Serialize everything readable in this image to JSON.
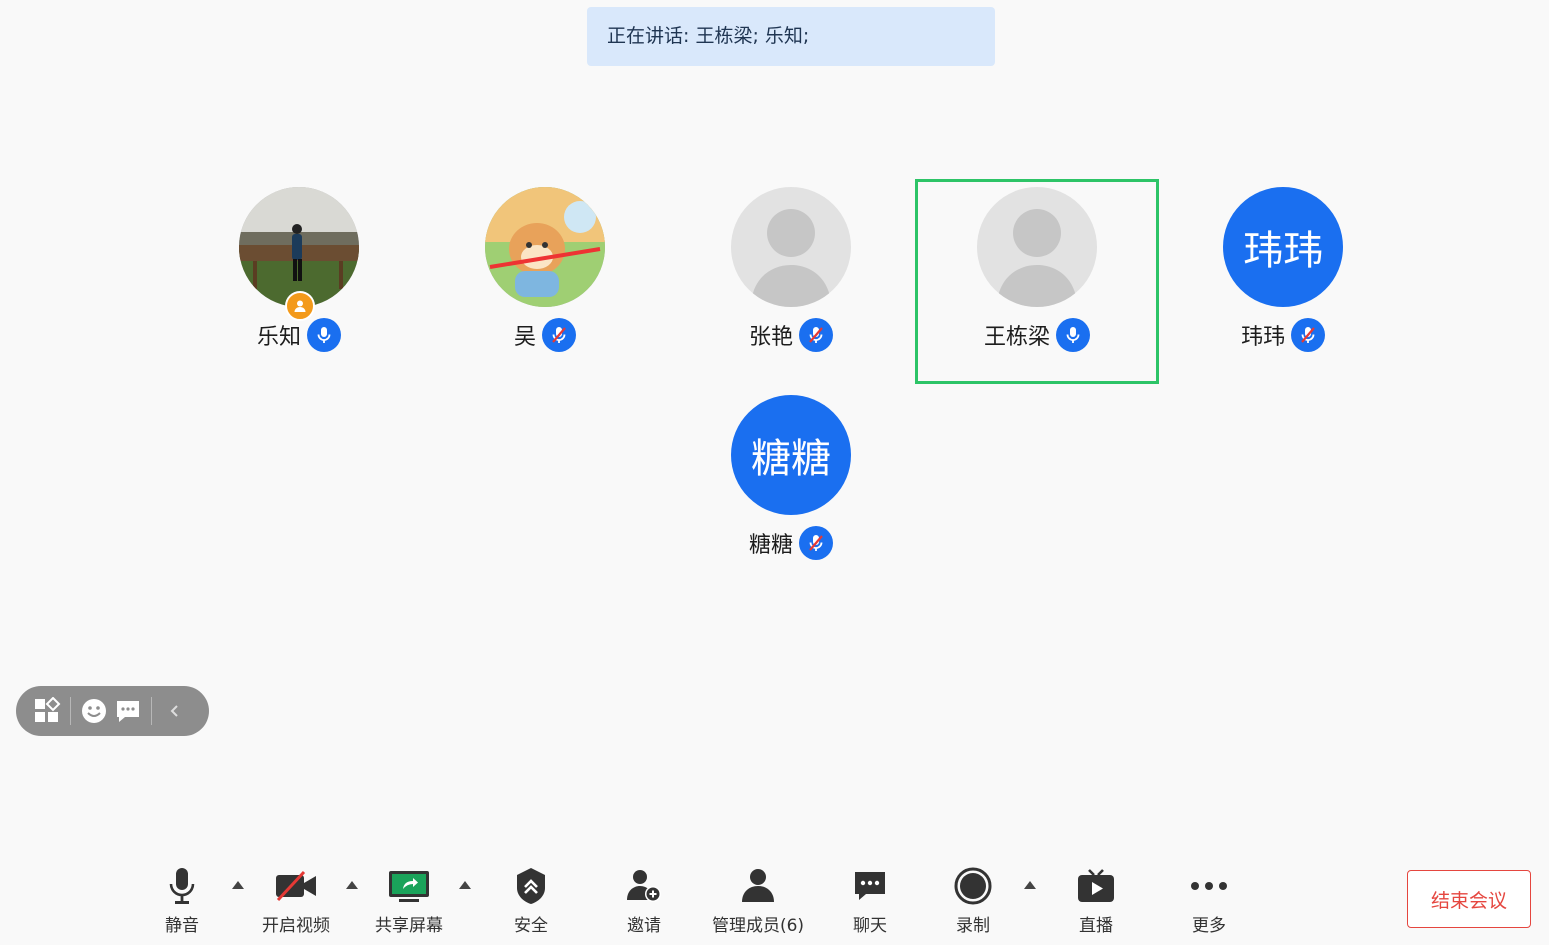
{
  "speaking_banner": {
    "text": "正在讲话: 王栋梁; 乐知;"
  },
  "participants": [
    {
      "name": "乐知",
      "avatar": "photo-landscape",
      "mic": "on",
      "host": true
    },
    {
      "name": "吴",
      "avatar": "photo-cartoon",
      "mic": "muted"
    },
    {
      "name": "张艳",
      "avatar": "default-silhouette",
      "mic": "muted"
    },
    {
      "name": "王栋梁",
      "avatar": "default-silhouette",
      "mic": "on",
      "active_speaker": true
    },
    {
      "name": "玮玮",
      "avatar_initials": "玮玮",
      "mic": "muted"
    },
    {
      "name": "糖糖",
      "avatar_initials": "糖糖",
      "mic": "muted"
    }
  ],
  "floating_bar": {
    "icons": [
      "layout-icon",
      "emoji-icon",
      "chat-bubble-icon",
      "collapse-chevron-icon"
    ]
  },
  "toolbar": {
    "mute_label": "静音",
    "video_label": "开启视频",
    "share_label": "共享屏幕",
    "security_label": "安全",
    "invite_label": "邀请",
    "members_label": "管理成员(6)",
    "chat_label": "聊天",
    "record_label": "录制",
    "live_label": "直播",
    "more_label": "更多"
  },
  "end_meeting_label": "结束会议",
  "colors": {
    "accent_blue": "#1a6ff0",
    "active_frame_green": "#2dc467",
    "end_red": "#e5463f",
    "banner_bg": "#d9e8fb",
    "host_badge_orange": "#f39a1b",
    "share_icon_green": "#1aa35a"
  }
}
